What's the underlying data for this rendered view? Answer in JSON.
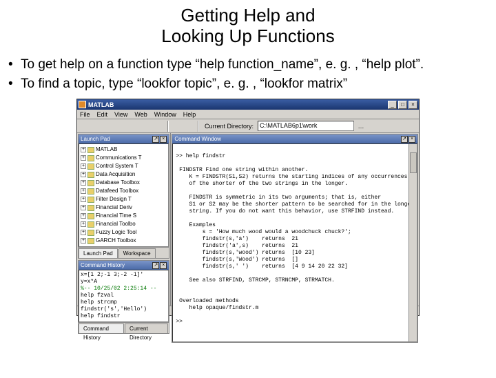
{
  "title_l1": "Getting Help and",
  "title_l2": "Looking Up Functions",
  "bullets": {
    "b1": "To get help on a function type “help function_name”, e. g. , “help plot”.",
    "b2": "To find a topic, type “lookfor topic”, e. g. , “lookfor matrix”"
  },
  "matlab": {
    "title": "MATLAB",
    "menu": {
      "file": "File",
      "edit": "Edit",
      "view": "View",
      "web": "Web",
      "window": "Window",
      "help": "Help"
    },
    "win": {
      "min": "_",
      "max": "□",
      "close": "×"
    },
    "toolbar": {
      "dir_label": "Current Directory:",
      "dir_value": "C:\\MATLAB6p1\\work",
      "browse": "…"
    },
    "launchpad": {
      "title": "Launch Pad",
      "items": {
        "i0": "MATLAB",
        "i1": "Communications T",
        "i2": "Control System T",
        "i3": "Data Acquisition",
        "i4": "Database Toolbox",
        "i5": "Datafeed Toolbox",
        "i6": "Filter Design T",
        "i7": "Financial Deriv",
        "i8": "Financial Time S",
        "i9": "Financial Toolbo",
        "i10": "Fuzzy Logic Tool",
        "i11": "GARCH Toolbox"
      },
      "tab1": "Launch Pad",
      "tab2": "Workspace"
    },
    "history": {
      "title": "Command History",
      "l0": "x=[1 2;-1 3;-2 -1]'",
      "l1": "y=x*A",
      "l2": "%-- 10/25/02  2:25:14 --",
      "l3": "help fzval",
      "l4": "help strcmp",
      "l5": "findstr('s','Hello')",
      "l6": "help findstr",
      "tab1": "Command History",
      "tab2": "Current Directory"
    },
    "cmdwin": {
      "title": "Command Window",
      "text": ">> help findstr\n\n FINDSTR Find one string within another.\n    K = FINDSTR(S1,S2) returns the starting indices of any occurrences\n    of the shorter of the two strings in the longer.\n\n    FINDSTR is symmetric in its two arguments; that is, either\n    S1 or S2 may be the shorter pattern to be searched for in the longer\n    string. If you do not want this behavior, use STRFIND instead.\n\n    Examples\n        s = 'How much wood would a woodchuck chuck?';\n        findstr(s,'a')    returns  21\n        findstr('a',s)    returns  21\n        findstr(s,'wood') returns  [10 23]\n        findstr(s,'Wood') returns  []\n        findstr(s,' ')    returns  [4 9 14 20 22 32]\n\n    See also STRFIND, STRCMP, STRNCMP, STRMATCH.\n\n\n Overloaded methods\n    help opaque/findstr.m\n\n>> "
    }
  }
}
